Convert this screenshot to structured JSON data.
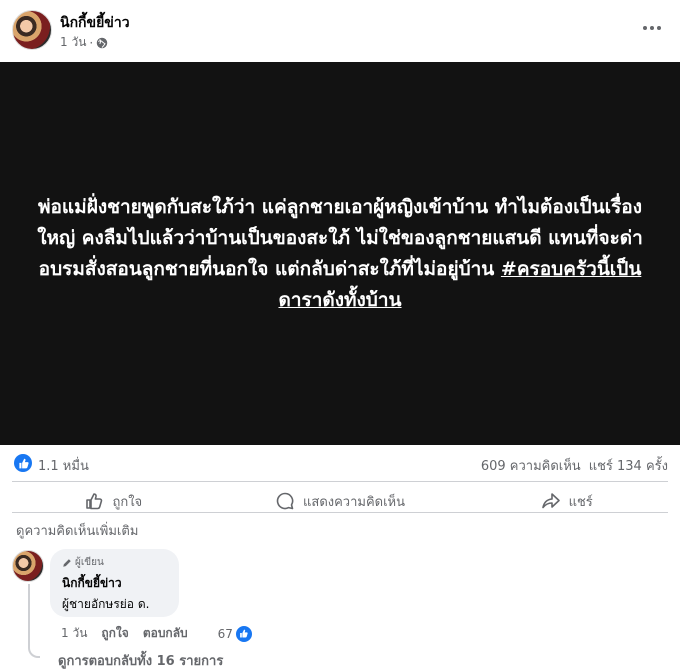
{
  "header": {
    "page_name": "นิกกี้ขยี้ข่าว",
    "time": "1 วัน",
    "separator": "·"
  },
  "post": {
    "text": "พ่อแม่ฝั่งชายพูดกับสะใภ้ว่า แค่ลูกชายเอาผู้หญิงเข้าบ้าน ทำไมต้องเป็นเรื่องใหญ่ คงลืมไปแล้วว่าบ้านเป็นของสะใภ้ ไม่ใช่ของลูกชายแสนดี แทนที่จะด่าอบรมสั่งสอนลูกชายที่นอกใจ แต่กลับด่าสะใภ้ที่ไม่อยู่บ้าน ",
    "hashtag": "#ครอบครัวนี้เป็นดาราดังทั้งบ้าน",
    "background": "#121212"
  },
  "stats": {
    "reactions": "1.1 หมื่น",
    "comments": "609 ความคิดเห็น",
    "shares": "แชร์ 134 ครั้ง"
  },
  "actions": {
    "like": "ถูกใจ",
    "comment": "แสดงความคิดเห็น",
    "share": "แชร์"
  },
  "more_comments": "ดูความคิดเห็นเพิ่มเติม",
  "comment": {
    "badge": "ผู้เขียน",
    "name": "นิกกี้ขยี้ข่าว",
    "body": "ผู้ชายอักษรย่อ ด.",
    "time": "1 วัน",
    "like": "ถูกใจ",
    "reply": "ตอบกลับ",
    "reaction_count": "67",
    "view_replies": "ดูการตอบกลับทั้ง 16 รายการ"
  },
  "colors": {
    "accent": "#1877f2",
    "secondary_text": "#65676b",
    "bubble": "#f0f2f5"
  }
}
